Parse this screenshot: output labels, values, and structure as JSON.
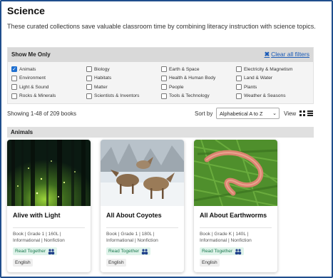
{
  "page": {
    "title": "Science",
    "intro": "These curated collections save valuable classroom time by combining literacy instruction with science topics."
  },
  "filters": {
    "heading": "Show Me Only",
    "clear_label": "Clear all filters",
    "items": [
      {
        "label": "Animals",
        "checked": true
      },
      {
        "label": "Biology",
        "checked": false
      },
      {
        "label": "Earth & Space",
        "checked": false
      },
      {
        "label": "Electricity & Magnetism",
        "checked": false
      },
      {
        "label": "Environment",
        "checked": false
      },
      {
        "label": "Habitats",
        "checked": false
      },
      {
        "label": "Health & Human Body",
        "checked": false
      },
      {
        "label": "Land & Water",
        "checked": false
      },
      {
        "label": "Light & Sound",
        "checked": false
      },
      {
        "label": "Matter",
        "checked": false
      },
      {
        "label": "People",
        "checked": false
      },
      {
        "label": "Plants",
        "checked": false
      },
      {
        "label": "Rocks & Minerals",
        "checked": false
      },
      {
        "label": "Scientists & Inventors",
        "checked": false
      },
      {
        "label": "Tools & Technology",
        "checked": false
      },
      {
        "label": "Weather & Seasons",
        "checked": false
      }
    ]
  },
  "results": {
    "count_text": "Showing 1-48 of 209 books",
    "sort_label": "Sort by",
    "sort_value": "Alphabetical A to Z",
    "view_label": "View"
  },
  "section": {
    "title": "Animals"
  },
  "books": [
    {
      "title": "Alive with Light",
      "meta_line1": "Book | Grade 1 | 160L |",
      "meta_line2": "Informational | Nonfiction",
      "tag": "Read Together",
      "language": "English"
    },
    {
      "title": "All About Coyotes",
      "meta_line1": "Book | Grade 1 | 180L |",
      "meta_line2": "Informational | Nonfiction",
      "tag": "Read Together",
      "language": "English"
    },
    {
      "title": "All About Earthworms",
      "meta_line1": "Book | Grade K | 140L |",
      "meta_line2": "Informational | Nonfiction",
      "tag": "Read Together",
      "language": "English"
    }
  ],
  "colors": {
    "accent": "#1e6fd0",
    "link": "#1a5bb8",
    "tag_bg": "#dff3ea",
    "tag_text": "#1b7a4f",
    "frame": "#1f4e8c"
  },
  "icons": {
    "clear": "close-x-icon",
    "checkbox_checked": "check-icon",
    "grid_view": "grid-view-icon",
    "list_view": "list-view-icon",
    "read_together": "people-icon",
    "sort_dropdown": "chevron-down-icon"
  }
}
